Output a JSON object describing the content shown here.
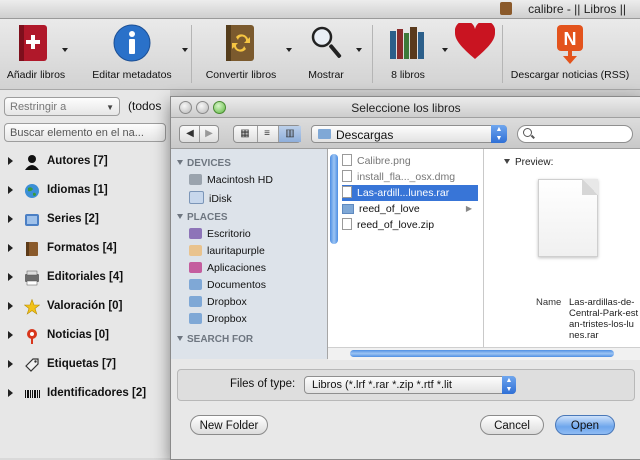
{
  "window": {
    "title": "calibre - || Libros ||"
  },
  "toolbar": {
    "items": [
      {
        "label": "Añadir libros",
        "icon": "add-book-icon"
      },
      {
        "label": "Editar metadatos",
        "icon": "info-icon"
      },
      {
        "label": "Convertir libros",
        "icon": "convert-book-icon"
      },
      {
        "label": "Mostrar",
        "icon": "magnifier-icon"
      },
      {
        "label": "8 libros",
        "icon": "books-icon"
      },
      {
        "label": "",
        "icon": "heart-icon"
      },
      {
        "label": "Descargar noticias (RSS)",
        "icon": "news-icon"
      }
    ]
  },
  "left": {
    "restrict_placeholder": "Restringir a",
    "todos_text": "(todos",
    "search_placeholder": "Buscar elemento en el na...",
    "tree": [
      {
        "label": "Autores [7]",
        "icon": "person-icon"
      },
      {
        "label": "Idiomas [1]",
        "icon": "globe-icon"
      },
      {
        "label": "Series [2]",
        "icon": "series-icon"
      },
      {
        "label": "Formatos [4]",
        "icon": "book-format-icon"
      },
      {
        "label": "Editoriales [4]",
        "icon": "publisher-icon"
      },
      {
        "label": "Valoración [0]",
        "icon": "star-icon"
      },
      {
        "label": "Noticias [0]",
        "icon": "news-pin-icon"
      },
      {
        "label": "Etiquetas [7]",
        "icon": "tag-icon"
      },
      {
        "label": "Identificadores [2]",
        "icon": "barcode-icon"
      }
    ]
  },
  "dialog": {
    "title": "Seleccione los libros",
    "location": "Descargas",
    "search_value": "",
    "sidebar": {
      "devices_header": "DEVICES",
      "devices": [
        "Macintosh HD",
        "iDisk"
      ],
      "places_header": "PLACES",
      "places": [
        "Escritorio",
        "lauritapurple",
        "Aplicaciones",
        "Documentos",
        "Dropbox",
        "Dropbox"
      ],
      "search_header": "SEARCH FOR"
    },
    "files": [
      {
        "name": "Calibre.png",
        "dim": true,
        "folder": false
      },
      {
        "name": "install_fla..._osx.dmg",
        "dim": true,
        "folder": false
      },
      {
        "name": "Las-ardill...lunes.rar",
        "dim": false,
        "folder": false,
        "selected": true
      },
      {
        "name": "reed_of_love",
        "dim": false,
        "folder": true
      },
      {
        "name": "reed_of_love.zip",
        "dim": false,
        "folder": false
      }
    ],
    "preview": {
      "label": "Preview:",
      "name_label": "Name",
      "name_value": "Las-ardillas-de-Central-Park-estan-tristes-los-lunes.rar"
    },
    "files_of_type_label": "Files of type:",
    "files_of_type_value": "Libros (*.lrf *.rar *.zip *.rtf *.lit",
    "buttons": {
      "new_folder": "New Folder",
      "cancel": "Cancel",
      "open": "Open"
    }
  },
  "colors": {
    "selection": "#3875d7",
    "default_button": "#6ea6ec"
  }
}
